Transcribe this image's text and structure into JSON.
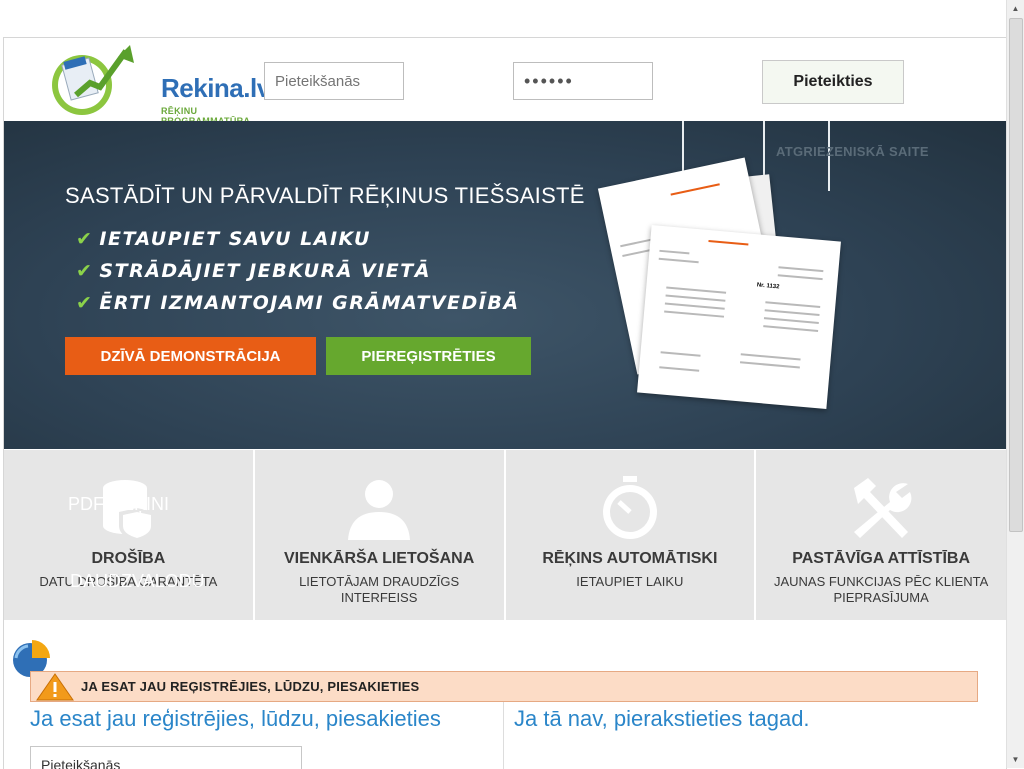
{
  "header": {
    "logo_text": "Rekina.lv",
    "logo_subtext": "RĒĶINU PROGRAMMATŪRA",
    "logo_badge": "Rēķins",
    "username_placeholder": "Pieteikšanās",
    "password_value": "••••••",
    "login_button": "Pieteikties"
  },
  "hero": {
    "title": "SASTĀDĪT UN PĀRVALDĪT RĒĶINUS TIEŠSAISTĒ",
    "features": [
      "IETAUPIET SAVU LAIKU",
      "STRĀDĀJIET JEBKURĀ VIETĀ",
      "ĒRTI IZMANTOJAMI GRĀMATVEDĪBĀ"
    ],
    "demo_button": "DZĪVĀ DEMONSTRĀCIJA",
    "register_button": "PIEREĢISTRĒTIES",
    "ghost_link": "ATGRIEZENISKĀ SAITE",
    "invoice_number": "Nr. 1132"
  },
  "features": [
    {
      "icon": "database-shield-icon",
      "title": "DROŠĪBA",
      "desc": "DATU DROŠĪBA GARANTĒTA"
    },
    {
      "icon": "user-icon",
      "title": "VIENKĀRŠA LIETOŠANA",
      "desc": "LIETOTĀJAM DRAUDZĪGS INTERFEISS"
    },
    {
      "icon": "stopwatch-icon",
      "title": "RĒĶINS AUTOMĀTISKI",
      "desc": "IETAUPIET LAIKU"
    },
    {
      "icon": "tools-icon",
      "title": "PASTĀVĪGA ATTĪSTĪBA",
      "desc": "JAUNAS FUNKCIJAS PĒC KLIENTA PIEPRASĪJUMA"
    }
  ],
  "ghost_texts": {
    "pdf": "PDF RĒĶINI",
    "sub": "DAUDZVALODU"
  },
  "warning": {
    "text": "JA ESAT JAU REĢISTRĒJIES, LŪDZU, PIESAKIETIES",
    "color": "#fcdcc6"
  },
  "login_section": {
    "left_heading": "Ja esat jau reģistrējies, lūdzu, piesakieties",
    "right_heading": "Ja tā nav, pierakstieties tagad.",
    "username_value": "Pieteikšanās"
  },
  "colors": {
    "accent_blue": "#2b86c9",
    "orange": "#e85d15",
    "green": "#66a82e"
  }
}
